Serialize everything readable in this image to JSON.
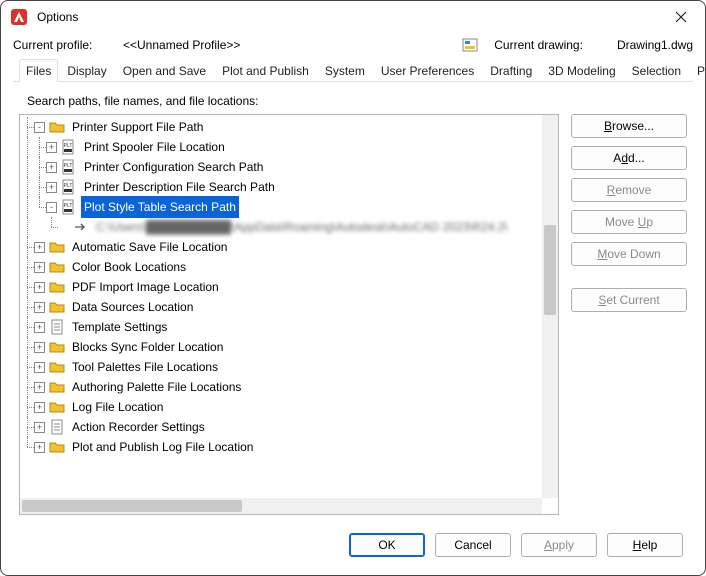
{
  "window": {
    "title": "Options"
  },
  "profile": {
    "current_profile_label": "Current profile:",
    "current_profile_value": "<<Unnamed Profile>>",
    "current_drawing_label": "Current drawing:",
    "current_drawing_value": "Drawing1.dwg"
  },
  "tabs": [
    {
      "label": "Files",
      "active": true
    },
    {
      "label": "Display"
    },
    {
      "label": "Open and Save"
    },
    {
      "label": "Plot and Publish"
    },
    {
      "label": "System"
    },
    {
      "label": "User Preferences"
    },
    {
      "label": "Drafting"
    },
    {
      "label": "3D Modeling"
    },
    {
      "label": "Selection"
    },
    {
      "label": "Profiles"
    }
  ],
  "files_tab": {
    "instruction": "Search paths, file names, and file locations:",
    "tree": [
      {
        "depth": 0,
        "exp": "-",
        "icon": "folder",
        "label": "Printer Support File Path"
      },
      {
        "depth": 1,
        "exp": "+",
        "icon": "plt",
        "label": "Print Spooler File Location"
      },
      {
        "depth": 1,
        "exp": "+",
        "icon": "plt",
        "label": "Printer Configuration Search Path"
      },
      {
        "depth": 1,
        "exp": "+",
        "icon": "plt",
        "label": "Printer Description File Search Path"
      },
      {
        "depth": 1,
        "exp": "-",
        "icon": "plt",
        "label": "Plot Style Table Search Path",
        "selected": true
      },
      {
        "depth": 2,
        "exp": "",
        "icon": "arrow",
        "label": "C:\\Users\\██████████\\AppData\\Roaming\\Autodesk\\AutoCAD 2023\\R24.2\\",
        "blur": true,
        "last": true
      },
      {
        "depth": 0,
        "exp": "+",
        "icon": "folder",
        "label": "Automatic Save File Location"
      },
      {
        "depth": 0,
        "exp": "+",
        "icon": "folder",
        "label": "Color Book Locations"
      },
      {
        "depth": 0,
        "exp": "+",
        "icon": "folder",
        "label": "PDF Import Image Location"
      },
      {
        "depth": 0,
        "exp": "+",
        "icon": "folder",
        "label": "Data Sources Location"
      },
      {
        "depth": 0,
        "exp": "+",
        "icon": "doc",
        "label": "Template Settings"
      },
      {
        "depth": 0,
        "exp": "+",
        "icon": "folder",
        "label": "Blocks Sync Folder Location"
      },
      {
        "depth": 0,
        "exp": "+",
        "icon": "folder",
        "label": "Tool Palettes File Locations"
      },
      {
        "depth": 0,
        "exp": "+",
        "icon": "folder",
        "label": "Authoring Palette File Locations"
      },
      {
        "depth": 0,
        "exp": "+",
        "icon": "folder",
        "label": "Log File Location"
      },
      {
        "depth": 0,
        "exp": "+",
        "icon": "doc",
        "label": "Action Recorder Settings"
      },
      {
        "depth": 0,
        "exp": "+",
        "icon": "folder",
        "label": "Plot and Publish Log File Location"
      }
    ],
    "side_buttons": [
      {
        "key": "browse",
        "text": "Browse...",
        "u": "B",
        "enabled": true
      },
      {
        "key": "add",
        "text": "Add...",
        "u": "d",
        "enabled": true
      },
      {
        "key": "remove",
        "text": "Remove",
        "u": "R",
        "enabled": false
      },
      {
        "key": "moveup",
        "text": "Move Up",
        "u": "U",
        "enabled": false
      },
      {
        "key": "movedown",
        "text": "Move Down",
        "u": "M",
        "enabled": false
      },
      {
        "key": "setcurrent",
        "text": "Set Current",
        "u": "S",
        "enabled": false
      }
    ]
  },
  "dialog_buttons": {
    "ok": "OK",
    "cancel": "Cancel",
    "apply": "Apply",
    "help": "Help"
  },
  "icons": {
    "logo": "autodesk-logo",
    "current_drawing": "dwg-icon"
  }
}
